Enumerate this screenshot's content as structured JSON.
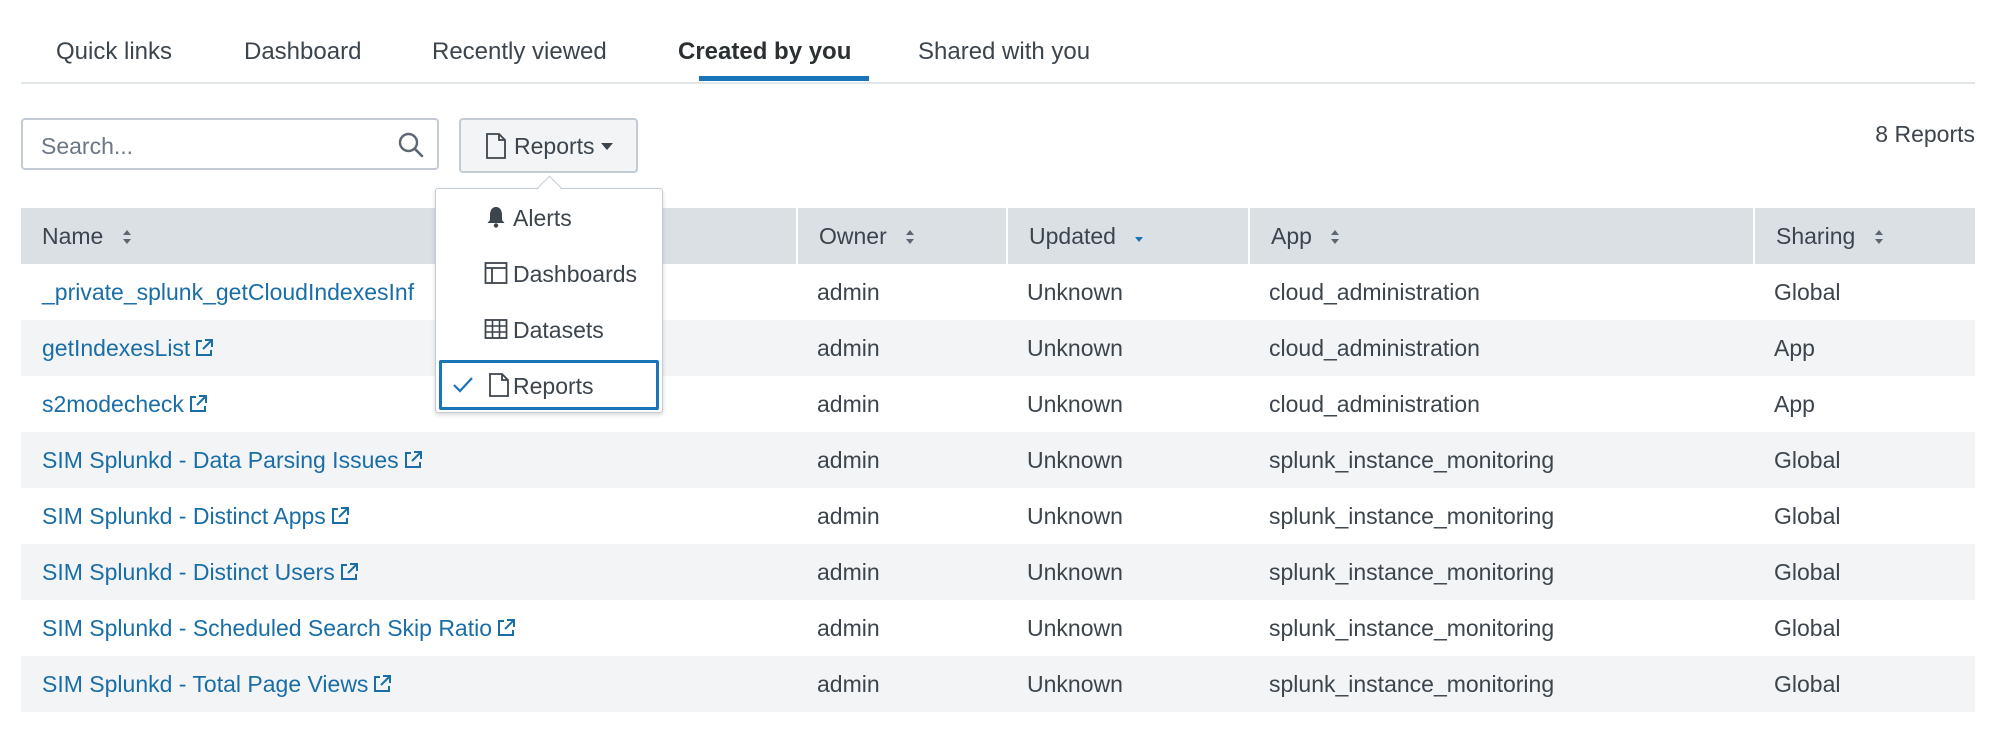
{
  "tabs": [
    {
      "label": "Quick links"
    },
    {
      "label": "Dashboard"
    },
    {
      "label": "Recently viewed"
    },
    {
      "label": "Created by you"
    },
    {
      "label": "Shared with you"
    }
  ],
  "active_tab": "Created by you",
  "search": {
    "placeholder": "Search...",
    "value": ""
  },
  "filter": {
    "selected": "Reports"
  },
  "count_label": "8 Reports",
  "dropdown": {
    "items": [
      {
        "label": "Alerts",
        "icon": "bell-icon",
        "selected": false
      },
      {
        "label": "Dashboards",
        "icon": "dashboard-icon",
        "selected": false
      },
      {
        "label": "Datasets",
        "icon": "table-icon",
        "selected": false
      },
      {
        "label": "Reports",
        "icon": "document-icon",
        "selected": true
      }
    ]
  },
  "table": {
    "columns": [
      {
        "label": "Name",
        "sort": "both"
      },
      {
        "label": "Owner",
        "sort": "both"
      },
      {
        "label": "Updated",
        "sort": "desc"
      },
      {
        "label": "App",
        "sort": "both"
      },
      {
        "label": "Sharing",
        "sort": "both"
      }
    ],
    "rows": [
      {
        "name": "_private_splunk_getCloudIndexesInf",
        "owner": "admin",
        "updated": "Unknown",
        "app": "cloud_administration",
        "sharing": "Global"
      },
      {
        "name": "getIndexesList",
        "owner": "admin",
        "updated": "Unknown",
        "app": "cloud_administration",
        "sharing": "App"
      },
      {
        "name": "s2modecheck",
        "owner": "admin",
        "updated": "Unknown",
        "app": "cloud_administration",
        "sharing": "App"
      },
      {
        "name": "SIM Splunkd - Data Parsing Issues",
        "owner": "admin",
        "updated": "Unknown",
        "app": "splunk_instance_monitoring",
        "sharing": "Global"
      },
      {
        "name": "SIM Splunkd - Distinct Apps",
        "owner": "admin",
        "updated": "Unknown",
        "app": "splunk_instance_monitoring",
        "sharing": "Global"
      },
      {
        "name": "SIM Splunkd - Distinct Users",
        "owner": "admin",
        "updated": "Unknown",
        "app": "splunk_instance_monitoring",
        "sharing": "Global"
      },
      {
        "name": "SIM Splunkd - Scheduled Search Skip Ratio",
        "owner": "admin",
        "updated": "Unknown",
        "app": "splunk_instance_monitoring",
        "sharing": "Global"
      },
      {
        "name": "SIM Splunkd - Total Page Views",
        "owner": "admin",
        "updated": "Unknown",
        "app": "splunk_instance_monitoring",
        "sharing": "Global"
      }
    ]
  },
  "colors": {
    "link": "#1a6ea8",
    "accent": "#1a74b8",
    "header_bg": "#dbe0e5",
    "stripe_bg": "#f2f4f5"
  }
}
